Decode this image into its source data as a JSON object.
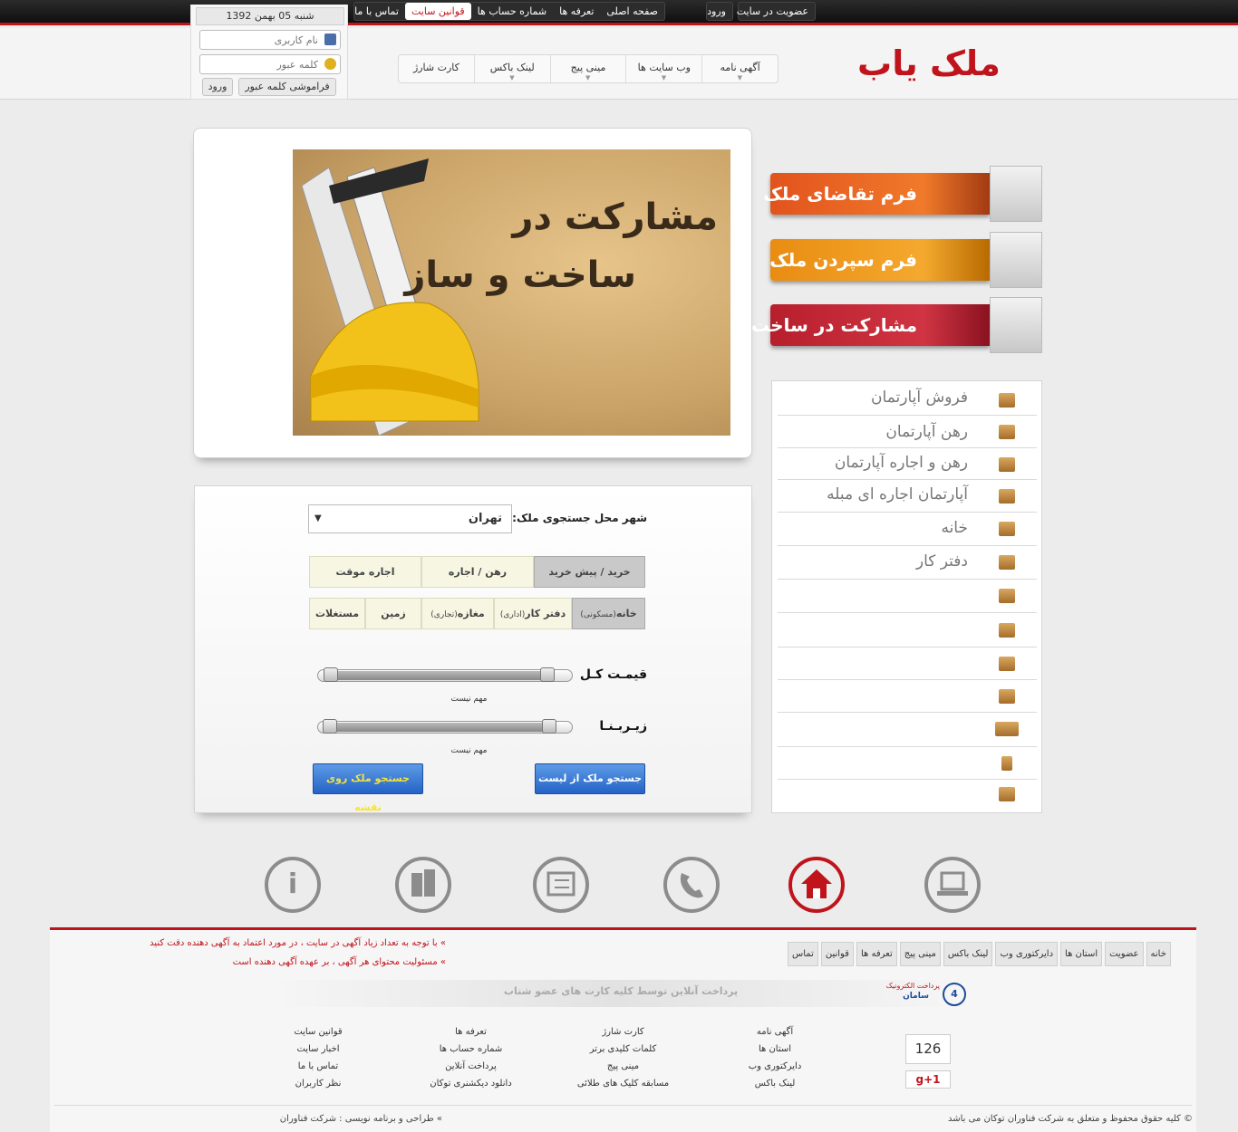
{
  "topbar": {
    "right_items": [
      "عضویت در سایت",
      "ورود"
    ],
    "left_items": [
      "صفحه اصلی",
      "تعرفه ها",
      "شماره حساب ها",
      "قوانین سایت",
      "تماس با ما"
    ]
  },
  "login": {
    "date": "شنبه 05 بهمن 1392",
    "username_placeholder": "نام کاربری",
    "password_placeholder": "کلمه عبور",
    "forgot_label": "فراموشی کلمه عبور",
    "login_label": "ورود"
  },
  "logo": {
    "text": "ملک یاب"
  },
  "menu": [
    "آگهی نامه",
    "وب سایت ها",
    "مینی پیج",
    "لینک باکس",
    "کارت شارژ"
  ],
  "banner": {
    "line1": "مشارکت در",
    "line2": "ساخت و ساز"
  },
  "promos": [
    {
      "label": "فرم تقاضای ملک",
      "color": "#e2531e"
    },
    {
      "label": "فرم سپردن ملک",
      "color": "#e98c12"
    },
    {
      "label": "مشارکت در ساخت",
      "color": "#b81f2d"
    }
  ],
  "categories": [
    "فروش آپارتمان",
    "رهن آپارتمان",
    "رهن و اجاره آپارتمان",
    "آپارتمان اجاره ای مبله",
    "خانه",
    "دفتر کار",
    "",
    "",
    "",
    "",
    "",
    "",
    ""
  ],
  "search": {
    "city_label": "شهر محل جستجوی ملک:",
    "city_value": "تهران",
    "deal_tabs": [
      "خرید / پیش خرید",
      "رهن / اجاره",
      "اجاره موقت"
    ],
    "type_tabs": [
      {
        "main": "خانه",
        "sub": "(مسکونی)"
      },
      {
        "main": "دفتر کار",
        "sub": "(اداری)"
      },
      {
        "main": "مغازه",
        "sub": "(تجاری)"
      },
      {
        "main": "زمین",
        "sub": ""
      },
      {
        "main": "مستغلات",
        "sub": ""
      }
    ],
    "price_label": "قیمـت کـل",
    "area_label": "زیـربـنـا",
    "price_note": "مهم نیست",
    "area_note": "مهم نیست",
    "list_button": "جستجو ملک از لیست",
    "map_button": "جستجو ملک روی نقشه"
  },
  "icons_row": [
    "info-icon",
    "buildings-icon",
    "listing-icon",
    "phone-icon",
    "home-icon",
    "laptop-icon"
  ],
  "footer": {
    "nav": [
      "خانه",
      "عضویت",
      "استان ها",
      "دایرکتوری وب",
      "لینک باکس",
      "مینی پیج",
      "تعرفه ها",
      "قوانین",
      "تماس"
    ],
    "notice1": "» با توجه به تعداد زیاد آگهی در سایت ، در مورد اعتماد به آگهی دهنده دقت کنید",
    "notice2": "» مسئولیت محتوای هر آگهی ، بر عهده آگهی دهنده است",
    "pay_text": "پرداخت آنلاین توسط کلیه کارت های عضو شتاب",
    "saman_line1": "پرداخت الکترونیک",
    "saman_line2": "سامان",
    "col1": [
      "آگهی نامه",
      "استان ها",
      "دایرکتوری وب",
      "لینک باکس"
    ],
    "col2": [
      "کارت شارژ",
      "کلمات کلیدی برتر",
      "مینی پیج",
      "مسابقه کلیک های طلائی"
    ],
    "col3": [
      "تعرفه ها",
      "شماره حساب ها",
      "پرداخت آنلاین",
      "دانلود دیکشنری توکان"
    ],
    "col4": [
      "قوانین سایت",
      "اخبار سایت",
      "تماس با ما",
      "نظر کاربران"
    ],
    "counter": "126",
    "gplus": "g+1",
    "copyright": "© کلیه حقوق محفوظ و متعلق به شرکت فناوران توکان می باشد",
    "design": "» طراحی و برنامه نویسی : شرکت فناوران"
  }
}
